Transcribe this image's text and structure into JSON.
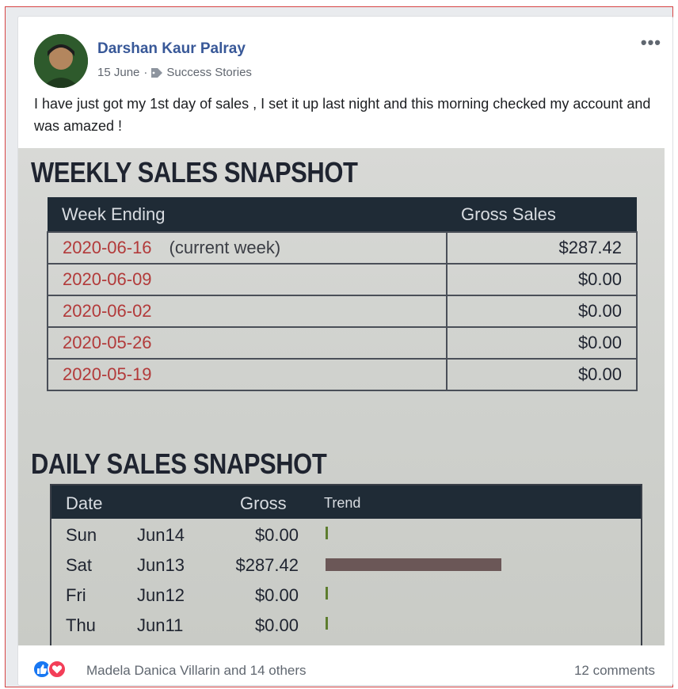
{
  "post": {
    "author": "Darshan Kaur Palray",
    "date": "15 June",
    "separator": "·",
    "group": "Success Stories",
    "more_label": "•••",
    "text": "I have just got my 1st day of sales , I set it up last night and this morning checked my account and was amazed !"
  },
  "photo": {
    "weekly_title": "WEEKLY SALES SNAPSHOT",
    "weekly_headers": [
      "Week Ending",
      "Gross Sales"
    ],
    "weekly_rows": [
      {
        "week": "2020-06-16",
        "note": "(current week)",
        "gross": "$287.42"
      },
      {
        "week": "2020-06-09",
        "note": "",
        "gross": "$0.00"
      },
      {
        "week": "2020-06-02",
        "note": "",
        "gross": "$0.00"
      },
      {
        "week": "2020-05-26",
        "note": "",
        "gross": "$0.00"
      },
      {
        "week": "2020-05-19",
        "note": "",
        "gross": "$0.00"
      }
    ],
    "daily_title": "DAILY SALES SNAPSHOT",
    "daily_headers": [
      "Date",
      "Gross",
      "Trend"
    ],
    "daily_rows": [
      {
        "day": "Sun",
        "date": "Jun14",
        "gross": "$0.00",
        "trend_fraction": 0
      },
      {
        "day": "Sat",
        "date": "Jun13",
        "gross": "$287.42",
        "trend_fraction": 1
      },
      {
        "day": "Fri",
        "date": "Jun12",
        "gross": "$0.00",
        "trend_fraction": 0
      },
      {
        "day": "Thu",
        "date": "Jun11",
        "gross": "$0.00",
        "trend_fraction": 0
      }
    ],
    "colors": {
      "header_bg": "#1f2b36",
      "date_text": "#b23a3a",
      "bar": "#6b5757",
      "tick": "#5d7d2e"
    }
  },
  "footer": {
    "reaction_icons": [
      "like-icon",
      "love-icon"
    ],
    "likers": "Madela Danica Villarin and 14 others",
    "comments": "12 comments"
  }
}
